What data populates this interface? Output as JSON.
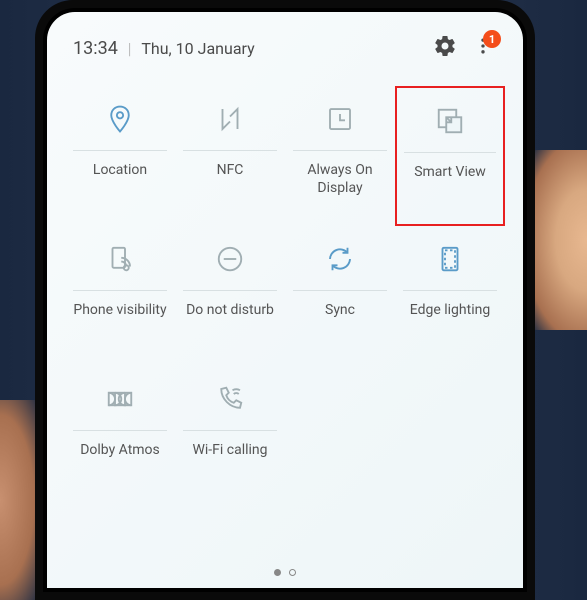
{
  "status": {
    "time": "13:34",
    "date": "Thu, 10 January",
    "badge_count": "1"
  },
  "tiles": {
    "location": "Location",
    "nfc": "NFC",
    "aod": "Always On Display",
    "smartview": "Smart View",
    "phonevis": "Phone visibility",
    "dnd": "Do not disturb",
    "sync": "Sync",
    "edge": "Edge lighting",
    "dolby": "Dolby Atmos",
    "wifi": "Wi-Fi calling"
  }
}
